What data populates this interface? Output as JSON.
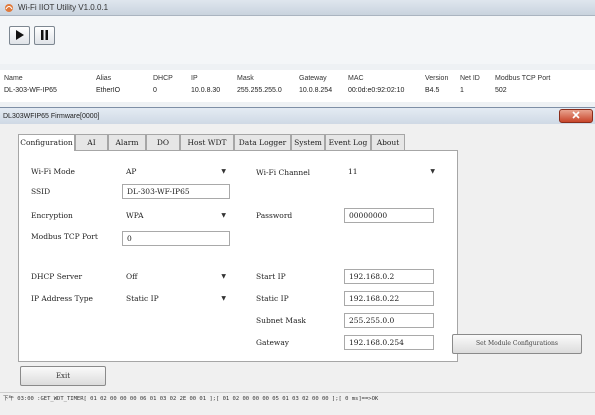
{
  "window": {
    "title": "Wi-Fi IIOT Utility V1.0.0.1"
  },
  "toolbar": {
    "play_icon": "play-icon",
    "pause_icon": "pause-icon"
  },
  "device_table": {
    "columns": [
      "Name",
      "Alias",
      "DHCP",
      "IP",
      "Mask",
      "Gateway",
      "MAC",
      "Version",
      "Net ID",
      "Modbus TCP Port"
    ],
    "rows": [
      [
        "DL-303-WF-IP65",
        "EtherIO",
        "0",
        "10.0.8.30",
        "255.255.255.0",
        "10.0.8.254",
        "00:0d:e0:92:02:10",
        "B4.5",
        "1",
        "502"
      ]
    ]
  },
  "dialog": {
    "title": "DL303WFIP65 Firmware[0000]",
    "tabs": [
      "Configuration",
      "AI",
      "Alarm",
      "DO",
      "Host WDT",
      "Data Logger",
      "System",
      "Event Log",
      "About"
    ],
    "active_tab": "Configuration",
    "labels": {
      "wifi_mode": "Wi-Fi Mode",
      "ssid": "SSID",
      "encryption": "Encryption",
      "modbus_port": "Modbus TCP Port",
      "dhcp_server": "DHCP Server",
      "ip_type": "IP Address Type",
      "wifi_channel": "Wi-Fi Channel",
      "password": "Password",
      "start_ip": "Start IP",
      "static_ip": "Static IP",
      "subnet_mask": "Subnet Mask",
      "gateway": "Gateway"
    },
    "values": {
      "wifi_mode": "AP",
      "ssid": "DL-303-WF-IP65",
      "encryption": "WPA",
      "modbus_port": "0",
      "dhcp_server": "Off",
      "ip_type": "Static IP",
      "wifi_channel": "11",
      "password": "00000000",
      "start_ip": "192.168.0.2",
      "static_ip": "192.168.0.22",
      "subnet_mask": "255.255.0.0",
      "gateway": "192.168.0.254"
    },
    "set_button": "Set Module Configurations",
    "exit_button": "Exit",
    "status": "下午 03:00 :GET_WDT_TIMER[ 01 02 00 00 00 06 01 03 02 2E 00 01 ];[ 01 02 00 00 00 05 01 03 02 00 00 ];[ 0 ms]==>OK"
  },
  "colors": {
    "close_button": "#c8452a",
    "title_gradient": "#cfd9e5"
  }
}
